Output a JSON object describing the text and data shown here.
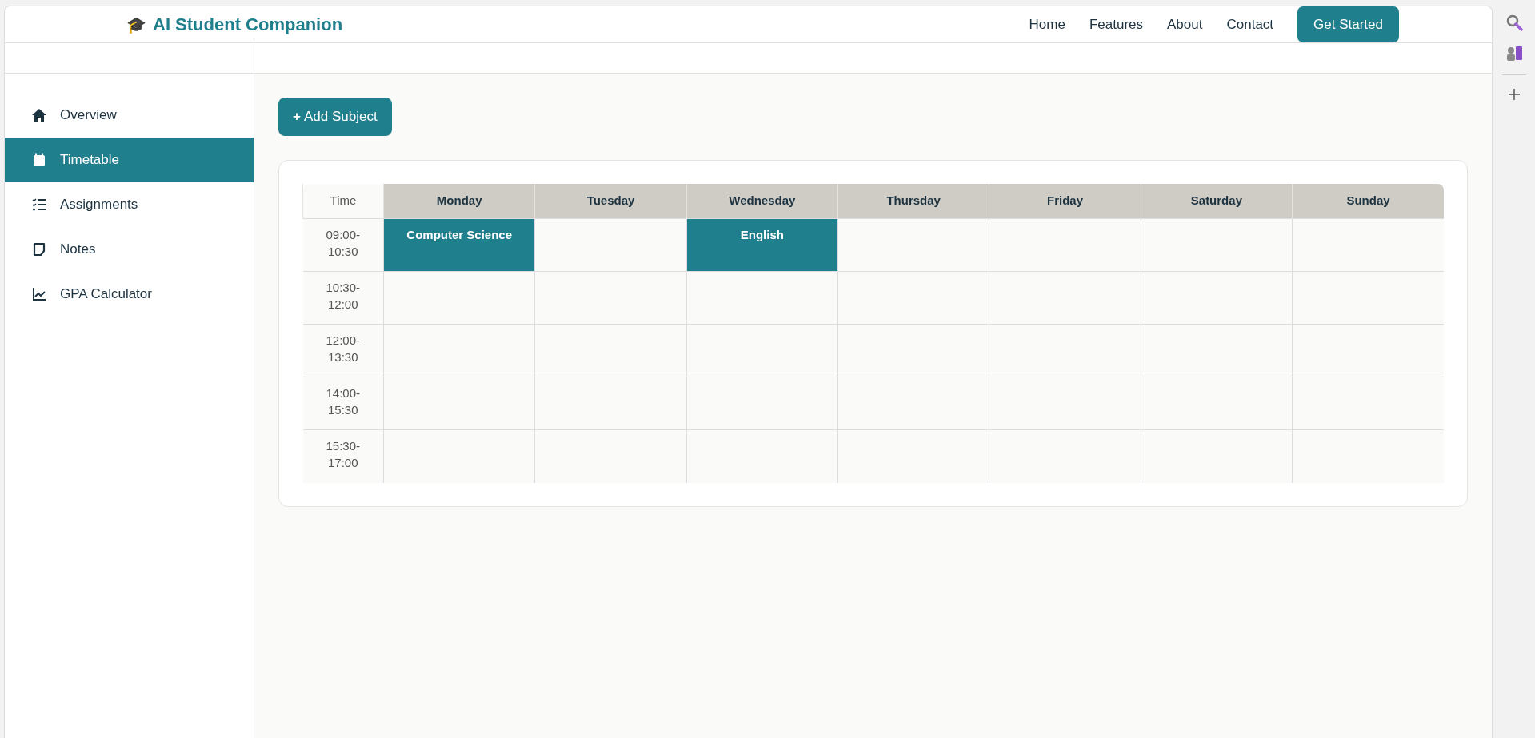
{
  "navbar": {
    "logo": "🎓",
    "brand": "AI Student Companion",
    "links": [
      "Home",
      "Features",
      "About",
      "Contact"
    ],
    "cta": "Get Started"
  },
  "sidebar": {
    "items": [
      {
        "label": "Overview",
        "selected": false
      },
      {
        "label": "Timetable",
        "selected": true
      },
      {
        "label": "Assignments",
        "selected": false
      },
      {
        "label": "Notes",
        "selected": false
      },
      {
        "label": "GPA Calculator",
        "selected": false
      }
    ]
  },
  "add_button": {
    "icon": "+",
    "label": "Add Subject"
  },
  "timetable": {
    "time_header": "Time",
    "days": [
      "Monday",
      "Tuesday",
      "Wednesday",
      "Thursday",
      "Friday",
      "Saturday",
      "Sunday"
    ],
    "rows": [
      {
        "time": "09:00-\n10:30",
        "cells": [
          "Computer Science",
          "",
          "English",
          "",
          "",
          "",
          ""
        ]
      },
      {
        "time": "10:30-\n12:00",
        "cells": [
          "",
          "",
          "",
          "",
          "",
          "",
          ""
        ]
      },
      {
        "time": "12:00-\n13:30",
        "cells": [
          "",
          "",
          "",
          "",
          "",
          "",
          ""
        ]
      },
      {
        "time": "14:00-\n15:30",
        "cells": [
          "",
          "",
          "",
          "",
          "",
          "",
          ""
        ]
      },
      {
        "time": "15:30-\n17:00",
        "cells": [
          "",
          "",
          "",
          "",
          "",
          "",
          ""
        ]
      }
    ]
  }
}
